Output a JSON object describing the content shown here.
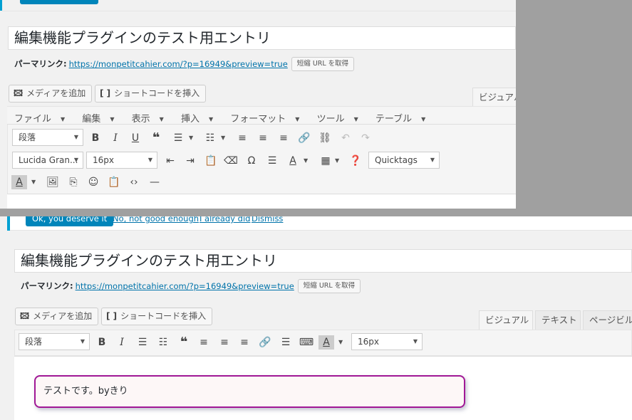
{
  "top_editor": {
    "post_title": "編集機能プラグインのテスト用エントリ",
    "permalink_label": "パーマリンク:",
    "permalink_url": "https://monpetitcahier.com/?p=16949&preview=true",
    "shortlink_button": "短縮 URL を取得",
    "add_media": "メディアを追加",
    "insert_shortcode": "ショートコードを挿入",
    "tab_visual": "ビジュアル",
    "menu": [
      "ファイル",
      "編集",
      "表示",
      "挿入",
      "フォーマット",
      "ツール",
      "テーブル"
    ],
    "format_select": "段落",
    "font_family_select": "Lucida Gran...",
    "font_size_select": "16px",
    "quicktags_select": "Quicktags"
  },
  "bottom_editor": {
    "notice_primary": "Ok, you deserve it",
    "notice_links": [
      "No, not good enough",
      "I already did",
      "Dismiss"
    ],
    "post_title": "編集機能プラグインのテスト用エントリ",
    "permalink_label": "パーマリンク:",
    "permalink_url": "https://monpetitcahier.com/?p=16949&preview=true",
    "shortlink_button": "短縮 URL を取得",
    "add_media": "メディアを追加",
    "insert_shortcode": "ショートコードを挿入",
    "tabs": [
      "ビジュアル",
      "テキスト",
      "ページビル"
    ],
    "format_select": "段落",
    "font_size_select": "16px",
    "content_text": "テストです。byきり"
  },
  "colors": {
    "accent_blue": "#0085ba",
    "link_blue": "#0073aa",
    "box_border": "#a11896"
  }
}
